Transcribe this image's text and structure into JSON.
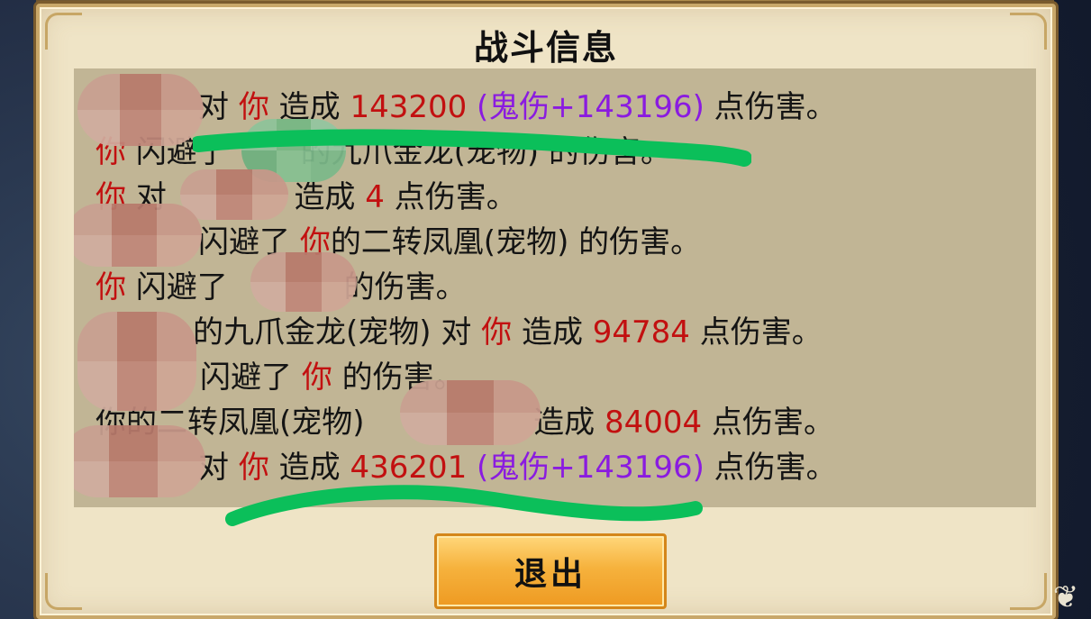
{
  "dialog": {
    "title": "战斗信息",
    "exit_label": "退出"
  },
  "log": [
    {
      "parts": [
        "对",
        "你",
        "造成",
        "143200",
        "(",
        "鬼伤+143196",
        ")",
        "点伤害。"
      ]
    },
    {
      "parts": [
        "你",
        "闪避了",
        "的九爪金龙(宠物) 的伤害。"
      ]
    },
    {
      "parts": [
        "你",
        "对",
        "造成",
        "4",
        "点伤害。"
      ]
    },
    {
      "parts": [
        "闪避了",
        "你",
        "的二转凤凰(宠物) 的伤害。"
      ]
    },
    {
      "parts": [
        "你",
        "闪避了",
        "的伤害。"
      ]
    },
    {
      "parts": [
        "的九爪金龙(宠物) 对",
        "你",
        "造成",
        "94784",
        "点伤害。"
      ]
    },
    {
      "parts": [
        "闪避了",
        "你",
        "的伤害。"
      ]
    },
    {
      "parts": [
        "你的二转凤凰(宠物)",
        "造成",
        "84004",
        "点伤害。"
      ]
    },
    {
      "parts": [
        "对",
        "你",
        "造成",
        "436201",
        "(",
        "鬼伤+143196",
        ")",
        "点伤害。"
      ]
    }
  ],
  "colors": {
    "you": "#c21010",
    "number": "#c21010",
    "ghost_damage": "#8a1be0",
    "panel": "#c1b595",
    "button": "#f6b23d"
  }
}
